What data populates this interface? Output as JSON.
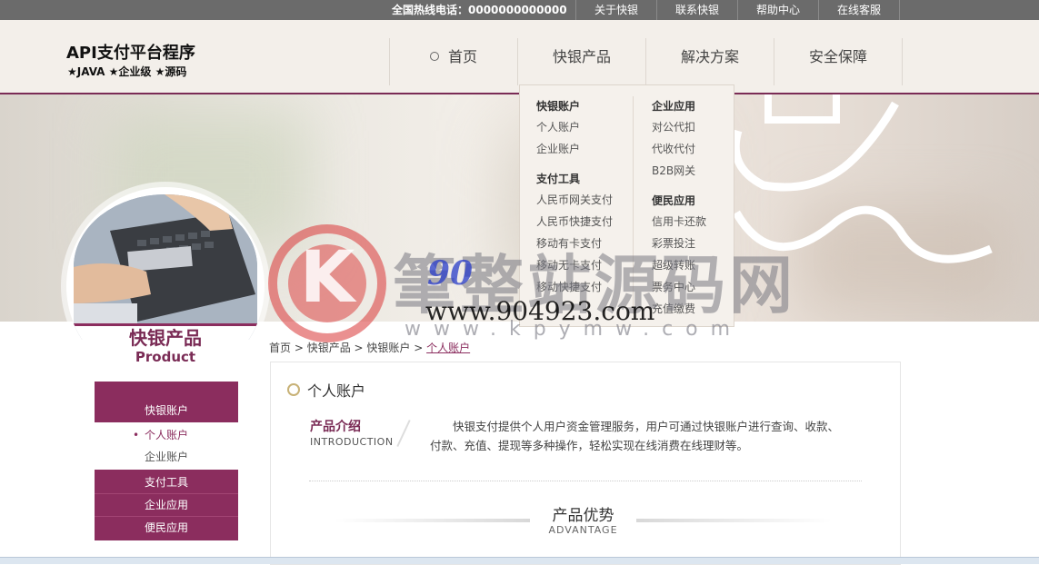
{
  "topbar": {
    "hotline": "全国热线电话：0000000000000",
    "links": [
      "关于快银",
      "联系快银",
      "帮助中心",
      "在线客服"
    ]
  },
  "header": {
    "logo_title": "API支付平台程序",
    "logo_sub": "★JAVA ★企业级 ★源码",
    "nav": [
      "首页",
      "快银产品",
      "解决方案",
      "安全保障"
    ]
  },
  "dropdown": {
    "col1": [
      {
        "heading": "快银账户",
        "items": [
          "个人账户",
          "企业账户"
        ]
      },
      {
        "heading": "支付工具",
        "items": [
          "人民币网关支付",
          "人民币快捷支付",
          "移动有卡支付",
          "移动无卡支付",
          "移动快捷支付"
        ]
      }
    ],
    "col2": [
      {
        "heading": "企业应用",
        "items": [
          "对公代扣",
          "代收代付",
          "B2B网关"
        ]
      },
      {
        "heading": "便民应用",
        "items": [
          "信用卡还款",
          "彩票投注",
          "超级转账",
          "票务中心",
          "充值缴费"
        ]
      }
    ]
  },
  "product_badge": {
    "cn": "快银产品",
    "en": "Product"
  },
  "sidebar": {
    "head": "快银账户",
    "sub_items": [
      "个人账户",
      "企业账户"
    ],
    "groups": [
      "支付工具",
      "企业应用",
      "便民应用"
    ]
  },
  "breadcrumb": {
    "items": [
      "首页",
      "快银产品",
      "快银账户"
    ],
    "current": "个人账户",
    "sep": " > "
  },
  "content": {
    "title": "个人账户",
    "intro_cn": "产品介绍",
    "intro_en": "INTRODUCTION",
    "intro_text": "快银支付提供个人用户资金管理服务，用户可通过快银账户进行查询、收款、付款、充值、提现等多种操作，轻松实现在线消费在线理财等。",
    "adv_cn": "产品优势",
    "adv_en": "ADVANTAGE"
  },
  "watermark": {
    "letter": "K",
    "cn": "筆整站源码网",
    "brand_prefix": "90",
    "url": "www.904923.com",
    "url2": "www.kpymw.com"
  },
  "colors": {
    "accent": "#8b2d5e",
    "topbar": "#6b6b6b",
    "header_bg": "#f3efea"
  }
}
